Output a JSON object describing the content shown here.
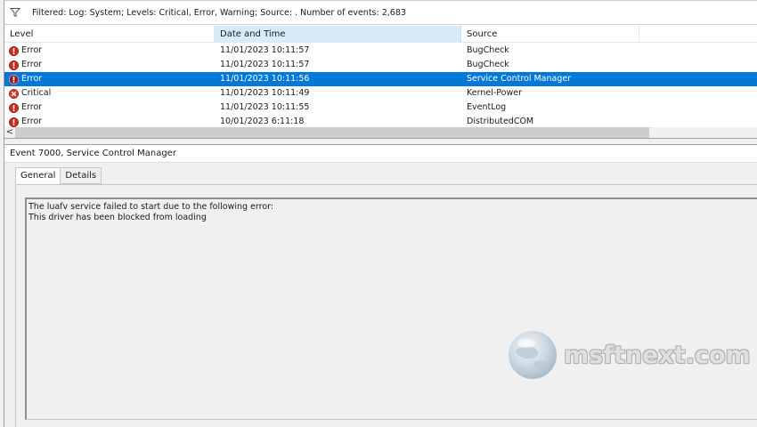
{
  "filter": {
    "icon": "funnel-icon",
    "text": "Filtered: Log: System; Levels: Critical, Error, Warning; Source: . Number of events: 2,683"
  },
  "grid": {
    "columns": [
      "Level",
      "Date and Time",
      "Source"
    ],
    "rows": [
      {
        "level": "Error",
        "date": "11/01/2023 10:11:57",
        "source": "BugCheck",
        "icon": "error-icon"
      },
      {
        "level": "Error",
        "date": "11/01/2023 10:11:57",
        "source": "BugCheck",
        "icon": "error-icon"
      },
      {
        "level": "Error",
        "date": "11/01/2023 10:11:56",
        "source": "Service Control Manager",
        "icon": "error-icon",
        "selected": true
      },
      {
        "level": "Critical",
        "date": "11/01/2023 10:11:49",
        "source": "Kernel-Power",
        "icon": "critical-icon"
      },
      {
        "level": "Error",
        "date": "11/01/2023 10:11:55",
        "source": "EventLog",
        "icon": "error-icon"
      },
      {
        "level": "Error",
        "date": "10/01/2023 6:11:18",
        "source": "DistributedCOM",
        "icon": "error-icon"
      }
    ],
    "scroll_left_glyph": "<"
  },
  "details": {
    "title": "Event 7000, Service Control Manager",
    "tabs": [
      "General",
      "Details"
    ],
    "active_tab": "General",
    "message_lines": [
      "The luafv service failed to start due to the following error:",
      "This driver has been blocked from loading"
    ]
  },
  "watermark": {
    "text": "msftnext.com",
    "icon": "globe-icon"
  },
  "colors": {
    "selection": "#0078d7",
    "error_red": "#c42b1c",
    "sorted_header": "#d9ebf9"
  }
}
